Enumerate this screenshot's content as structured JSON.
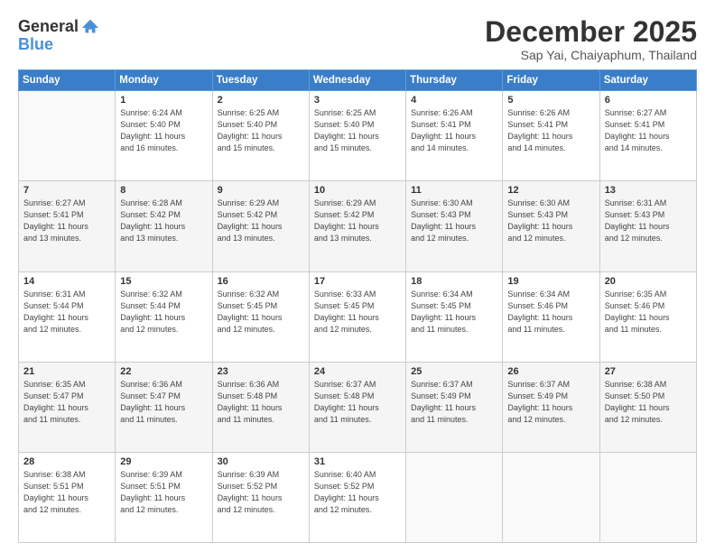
{
  "logo": {
    "general": "General",
    "blue": "Blue"
  },
  "header": {
    "month": "December 2025",
    "location": "Sap Yai, Chaiyaphum, Thailand"
  },
  "days": [
    "Sunday",
    "Monday",
    "Tuesday",
    "Wednesday",
    "Thursday",
    "Friday",
    "Saturday"
  ],
  "weeks": [
    [
      {
        "day": "",
        "info": ""
      },
      {
        "day": "1",
        "info": "Sunrise: 6:24 AM\nSunset: 5:40 PM\nDaylight: 11 hours\nand 16 minutes."
      },
      {
        "day": "2",
        "info": "Sunrise: 6:25 AM\nSunset: 5:40 PM\nDaylight: 11 hours\nand 15 minutes."
      },
      {
        "day": "3",
        "info": "Sunrise: 6:25 AM\nSunset: 5:40 PM\nDaylight: 11 hours\nand 15 minutes."
      },
      {
        "day": "4",
        "info": "Sunrise: 6:26 AM\nSunset: 5:41 PM\nDaylight: 11 hours\nand 14 minutes."
      },
      {
        "day": "5",
        "info": "Sunrise: 6:26 AM\nSunset: 5:41 PM\nDaylight: 11 hours\nand 14 minutes."
      },
      {
        "day": "6",
        "info": "Sunrise: 6:27 AM\nSunset: 5:41 PM\nDaylight: 11 hours\nand 14 minutes."
      }
    ],
    [
      {
        "day": "7",
        "info": "Sunrise: 6:27 AM\nSunset: 5:41 PM\nDaylight: 11 hours\nand 13 minutes."
      },
      {
        "day": "8",
        "info": "Sunrise: 6:28 AM\nSunset: 5:42 PM\nDaylight: 11 hours\nand 13 minutes."
      },
      {
        "day": "9",
        "info": "Sunrise: 6:29 AM\nSunset: 5:42 PM\nDaylight: 11 hours\nand 13 minutes."
      },
      {
        "day": "10",
        "info": "Sunrise: 6:29 AM\nSunset: 5:42 PM\nDaylight: 11 hours\nand 13 minutes."
      },
      {
        "day": "11",
        "info": "Sunrise: 6:30 AM\nSunset: 5:43 PM\nDaylight: 11 hours\nand 12 minutes."
      },
      {
        "day": "12",
        "info": "Sunrise: 6:30 AM\nSunset: 5:43 PM\nDaylight: 11 hours\nand 12 minutes."
      },
      {
        "day": "13",
        "info": "Sunrise: 6:31 AM\nSunset: 5:43 PM\nDaylight: 11 hours\nand 12 minutes."
      }
    ],
    [
      {
        "day": "14",
        "info": "Sunrise: 6:31 AM\nSunset: 5:44 PM\nDaylight: 11 hours\nand 12 minutes."
      },
      {
        "day": "15",
        "info": "Sunrise: 6:32 AM\nSunset: 5:44 PM\nDaylight: 11 hours\nand 12 minutes."
      },
      {
        "day": "16",
        "info": "Sunrise: 6:32 AM\nSunset: 5:45 PM\nDaylight: 11 hours\nand 12 minutes."
      },
      {
        "day": "17",
        "info": "Sunrise: 6:33 AM\nSunset: 5:45 PM\nDaylight: 11 hours\nand 12 minutes."
      },
      {
        "day": "18",
        "info": "Sunrise: 6:34 AM\nSunset: 5:45 PM\nDaylight: 11 hours\nand 11 minutes."
      },
      {
        "day": "19",
        "info": "Sunrise: 6:34 AM\nSunset: 5:46 PM\nDaylight: 11 hours\nand 11 minutes."
      },
      {
        "day": "20",
        "info": "Sunrise: 6:35 AM\nSunset: 5:46 PM\nDaylight: 11 hours\nand 11 minutes."
      }
    ],
    [
      {
        "day": "21",
        "info": "Sunrise: 6:35 AM\nSunset: 5:47 PM\nDaylight: 11 hours\nand 11 minutes."
      },
      {
        "day": "22",
        "info": "Sunrise: 6:36 AM\nSunset: 5:47 PM\nDaylight: 11 hours\nand 11 minutes."
      },
      {
        "day": "23",
        "info": "Sunrise: 6:36 AM\nSunset: 5:48 PM\nDaylight: 11 hours\nand 11 minutes."
      },
      {
        "day": "24",
        "info": "Sunrise: 6:37 AM\nSunset: 5:48 PM\nDaylight: 11 hours\nand 11 minutes."
      },
      {
        "day": "25",
        "info": "Sunrise: 6:37 AM\nSunset: 5:49 PM\nDaylight: 11 hours\nand 11 minutes."
      },
      {
        "day": "26",
        "info": "Sunrise: 6:37 AM\nSunset: 5:49 PM\nDaylight: 11 hours\nand 12 minutes."
      },
      {
        "day": "27",
        "info": "Sunrise: 6:38 AM\nSunset: 5:50 PM\nDaylight: 11 hours\nand 12 minutes."
      }
    ],
    [
      {
        "day": "28",
        "info": "Sunrise: 6:38 AM\nSunset: 5:51 PM\nDaylight: 11 hours\nand 12 minutes."
      },
      {
        "day": "29",
        "info": "Sunrise: 6:39 AM\nSunset: 5:51 PM\nDaylight: 11 hours\nand 12 minutes."
      },
      {
        "day": "30",
        "info": "Sunrise: 6:39 AM\nSunset: 5:52 PM\nDaylight: 11 hours\nand 12 minutes."
      },
      {
        "day": "31",
        "info": "Sunrise: 6:40 AM\nSunset: 5:52 PM\nDaylight: 11 hours\nand 12 minutes."
      },
      {
        "day": "",
        "info": ""
      },
      {
        "day": "",
        "info": ""
      },
      {
        "day": "",
        "info": ""
      }
    ]
  ]
}
